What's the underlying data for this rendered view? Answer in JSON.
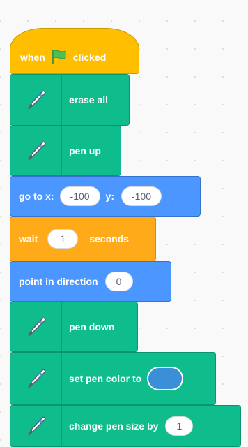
{
  "blocks": {
    "when_flag": {
      "when": "when",
      "clicked": "clicked"
    },
    "erase_all": {
      "label": "erase all"
    },
    "pen_up": {
      "label": "pen up"
    },
    "go_to": {
      "prefix": "go to x:",
      "x": "-100",
      "ylabel": "y:",
      "y": "-100"
    },
    "wait": {
      "prefix": "wait",
      "value": "1",
      "suffix": "seconds"
    },
    "point_direction": {
      "label": "point in direction",
      "value": "0"
    },
    "pen_down": {
      "label": "pen down"
    },
    "set_pen_color": {
      "label": "set pen color to",
      "color": "#3a8fd6"
    },
    "change_pen_size": {
      "label": "change pen size by",
      "value": "1"
    }
  },
  "colors": {
    "events": "#ffbf00",
    "pen": "#0fbd8c",
    "motion": "#4c97ff",
    "control": "#ffab19"
  },
  "icons": {
    "flag": "green-flag-icon",
    "pen": "pen-icon"
  }
}
